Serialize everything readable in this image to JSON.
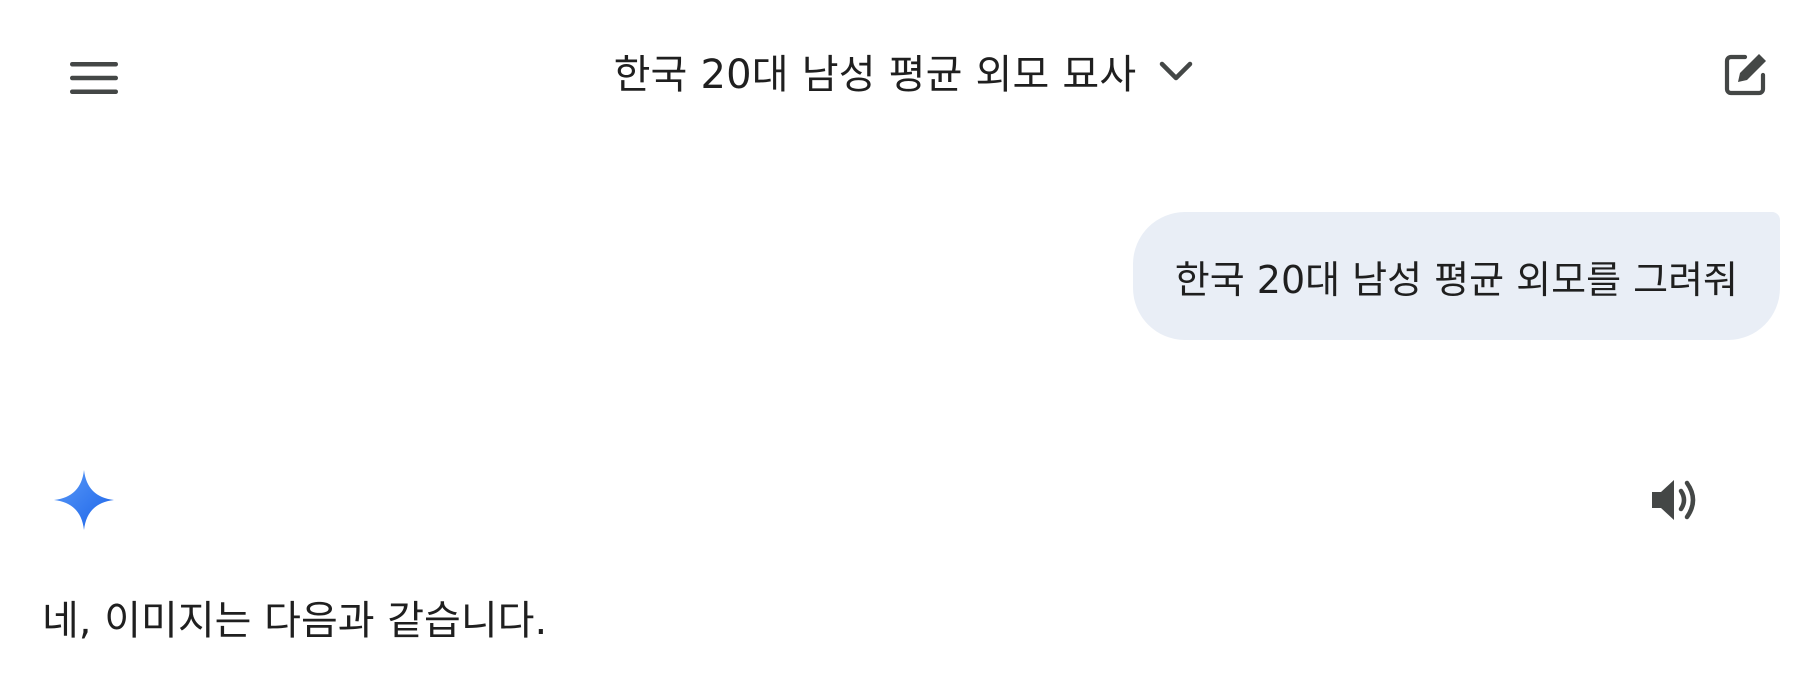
{
  "header": {
    "title": "한국 20대 남성 평균 외모 묘사",
    "menu_icon": "hamburger-menu-icon",
    "dropdown_icon": "chevron-down-icon",
    "new_chat_icon": "edit-icon"
  },
  "conversation": {
    "user_message": "한국 20대 남성 평균 외모를 그려줘",
    "assistant": {
      "avatar_icon": "gemini-sparkle-icon",
      "speaker_icon": "speaker-icon",
      "response_text": "네, 이미지는 다음과 같습니다."
    }
  },
  "colors": {
    "bubble_bg": "#e9eef6",
    "icon": "#444746",
    "text": "#1f1f1f",
    "sparkle_start": "#4f8df6",
    "sparkle_end": "#1a62e8"
  }
}
